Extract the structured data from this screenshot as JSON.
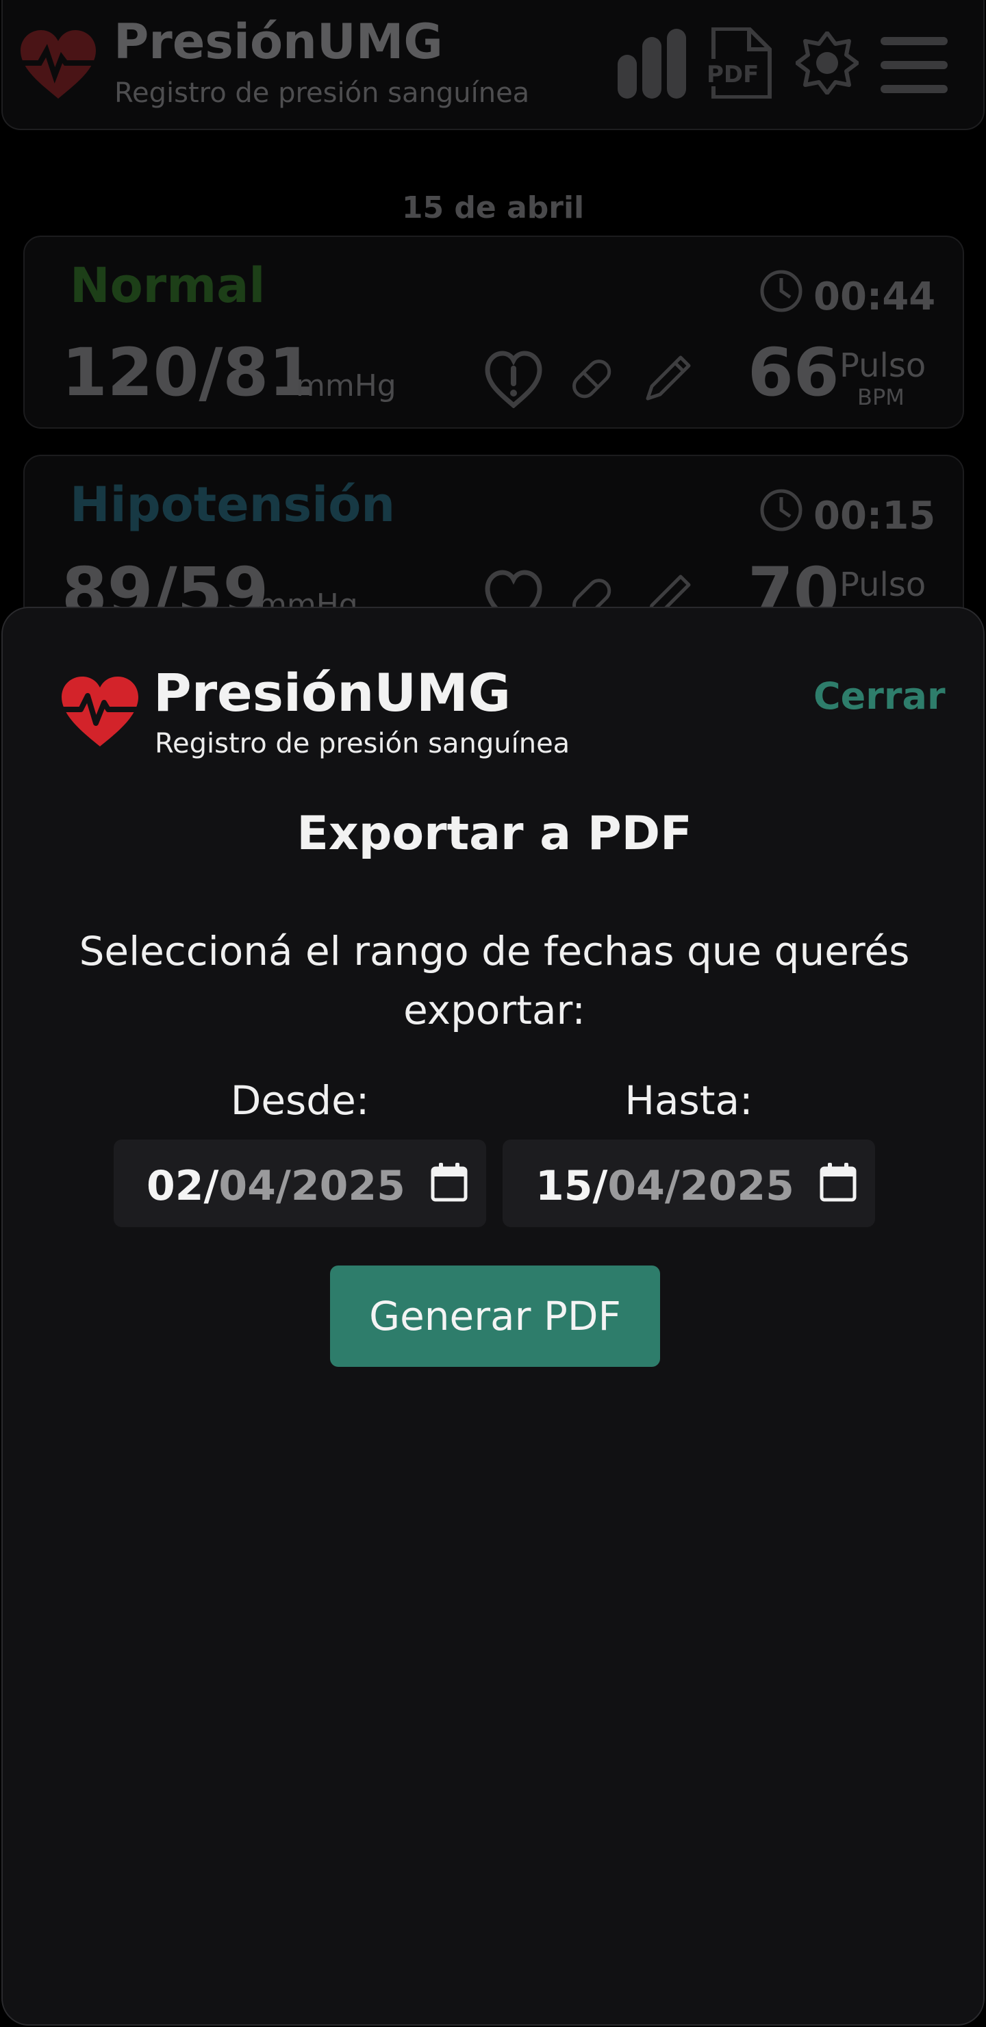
{
  "app": {
    "title": "PresiónUMG",
    "subtitle": "Registro de presión sanguínea",
    "header_icons": [
      "bar-chart-icon",
      "pdf-icon",
      "theme-toggle-icon",
      "menu-icon"
    ]
  },
  "history": {
    "date_heading": "15 de abril",
    "readings": [
      {
        "category": "Normal",
        "category_color": "#1d3f18",
        "time": "00:44",
        "pressure": "120/81",
        "unit": "mmHg",
        "pulse": "66",
        "pulse_label": "Pulso",
        "pulse_unit": "BPM"
      },
      {
        "category": "Hipotensión",
        "category_color": "#173944",
        "time": "00:15",
        "pressure": "89/59",
        "unit": "mmHg",
        "pulse": "70",
        "pulse_label": "Pulso"
      }
    ]
  },
  "modal": {
    "title": "PresiónUMG",
    "subtitle": "Registro de presión sanguínea",
    "close_label": "Cerrar",
    "heading": "Exportar a PDF",
    "instruction": "Seleccioná el rango de fechas que querés exportar:",
    "from_label": "Desde:",
    "from_day": "02/",
    "from_rest": "04/2025",
    "to_label": "Hasta:",
    "to_day": "15/",
    "to_rest": "04/2025",
    "generate_label": "Generar PDF"
  },
  "colors": {
    "accent": "#2e7d6b",
    "heart": "#d3232a",
    "sheet_bg": "#111113"
  }
}
